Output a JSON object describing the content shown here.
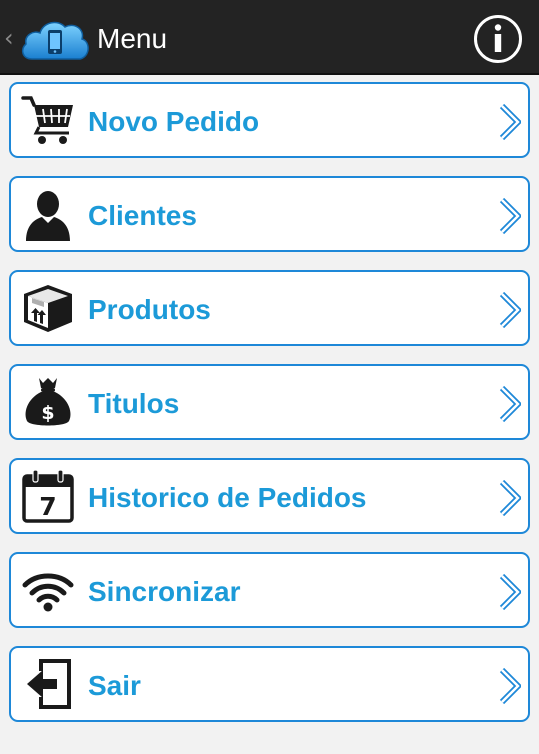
{
  "actionbar": {
    "title": "Menu",
    "app_icon": "cloud-phone-icon",
    "info_icon": "info-icon"
  },
  "menu": {
    "items": [
      {
        "label": "Novo Pedido",
        "icon": "shopping-cart-icon"
      },
      {
        "label": "Clientes",
        "icon": "person-icon"
      },
      {
        "label": "Produtos",
        "icon": "box-icon"
      },
      {
        "label": "Titulos",
        "icon": "money-bag-icon"
      },
      {
        "label": "Historico de Pedidos",
        "icon": "calendar-icon"
      },
      {
        "label": "Sincronizar",
        "icon": "wifi-icon"
      },
      {
        "label": "Sair",
        "icon": "logout-icon"
      }
    ]
  },
  "colors": {
    "actionbar_bg": "#232323",
    "accent_blue": "#1c9ad8",
    "border_blue": "#1e88d8",
    "page_bg": "#f2f2f2"
  }
}
